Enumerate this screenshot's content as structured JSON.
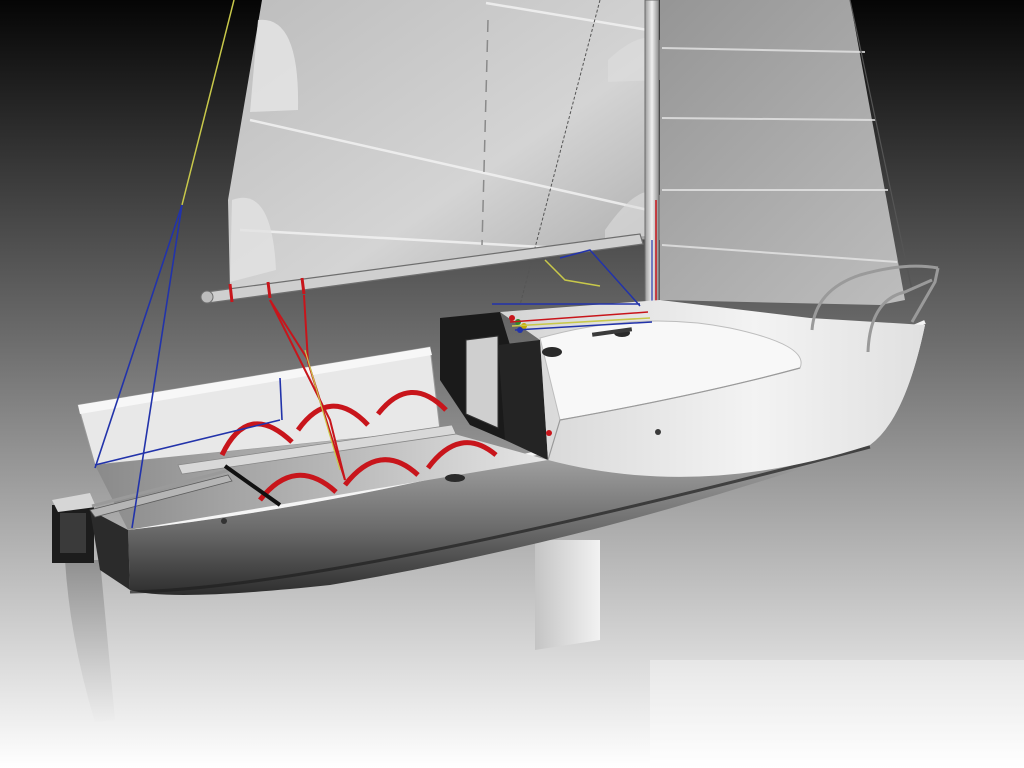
{
  "scene": {
    "subject": "sailboat-3d-render",
    "colors": {
      "background_top": "#050505",
      "background_bottom": "#ffffff",
      "hull_light": "#f4f4f4",
      "hull_shadow": "#3a3a3a",
      "sail": "#c9c9c9",
      "mast": "#d8d8d8",
      "hoop_red": "#c8151b",
      "line_blue": "#2233aa",
      "line_red": "#cc2222",
      "line_yellow": "#c8c84a",
      "trim_black": "#111111"
    }
  }
}
